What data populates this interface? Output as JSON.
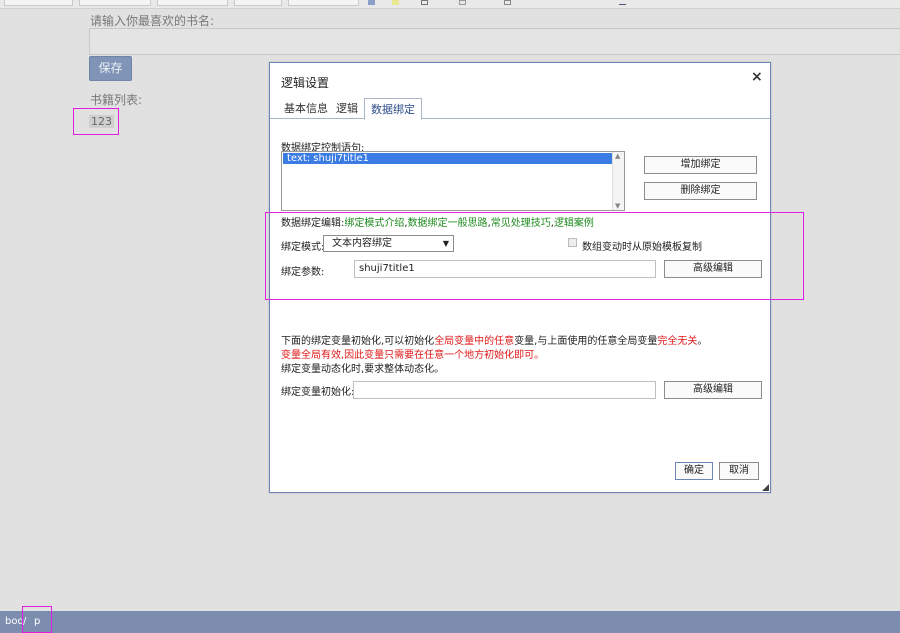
{
  "editor": {
    "prompt_label": "请输入你最喜欢的书名:",
    "save_label": "保存",
    "book_list_label": "书籍列表:",
    "book_list_value": "123"
  },
  "status_bar": {
    "crumb_body": "bod",
    "crumb_separator": "/",
    "crumb_p": "p",
    "color": "#7d8db0"
  },
  "dialog": {
    "title": "逻辑设置",
    "close_icon": "×",
    "tabs": [
      {
        "label": "基本信息"
      },
      {
        "label": "逻辑"
      },
      {
        "label": "数据绑定",
        "active": true
      }
    ],
    "control_label": "数据绑定控制语句:",
    "bindings": [
      "text: shuji7title1"
    ],
    "add_binding_label": "增加绑定",
    "delete_binding_label": "删除绑定",
    "edit_prefix": "数据绑定编辑:",
    "edit_links": [
      "绑定模式介绍",
      "数据绑定一般思路",
      "常见处理技巧",
      "逻辑案例"
    ],
    "edit_separator": ",",
    "mode_label": "绑定模式:",
    "mode_value": "文本内容绑定",
    "copy_checkbox_label": "数组变动时从原始模板复制",
    "param_label": "绑定参数:",
    "param_value": "shuji7title1",
    "advanced_label": "高级编辑",
    "note_part1": "下面的绑定变量初始化,可以初始化",
    "note_part2": "全局变量中的任意",
    "note_part3": "变量,与上面使用的任意全局变量",
    "note_part4": "完全无关",
    "note_part5": "。",
    "note_line2": "变量全局有效,因此变量只需要在任意一个地方初始化即可。",
    "note_line3": "绑定变量动态化时,要求整体动态化。",
    "init_label": "绑定变量初始化:",
    "init_value": "",
    "ok_label": "确定",
    "cancel_label": "取消",
    "accent_color": "#3a7be4",
    "highlight_color": "#e020e0"
  }
}
